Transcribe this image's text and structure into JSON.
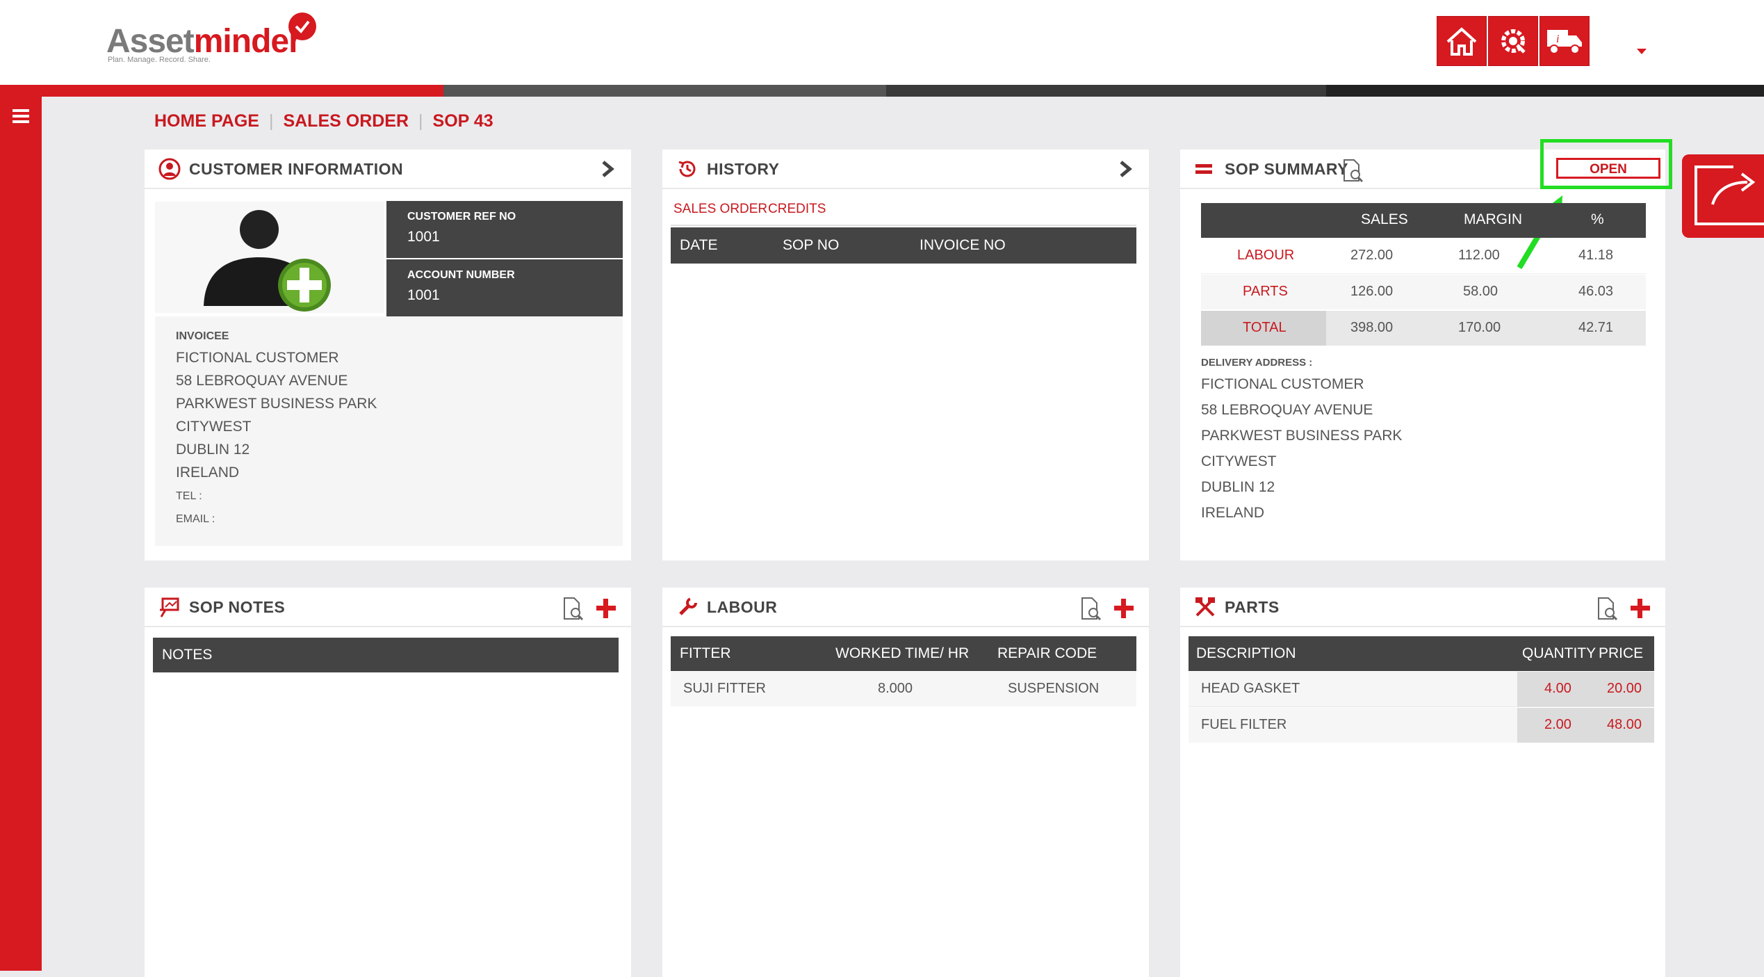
{
  "brand": {
    "name_a": "Asset",
    "name_b": "minder",
    "tagline": "Plan. Manage. Record. Share."
  },
  "topbar": {
    "home_icon": "home-icon",
    "settings_icon": "gear-wrench-icon",
    "delivery_icon": "delivery-truck-icon"
  },
  "breadcrumb": {
    "home": "HOME PAGE",
    "sales_order": "SALES ORDER",
    "current": "SOP 43"
  },
  "customer": {
    "title": "CUSTOMER INFORMATION",
    "ref_label": "CUSTOMER REF NO",
    "ref_value": "1001",
    "acct_label": "ACCOUNT NUMBER",
    "acct_value": "1001",
    "invoicee_label": "INVOICEE",
    "address": [
      "FICTIONAL CUSTOMER",
      "58 LEBROQUAY AVENUE",
      "PARKWEST BUSINESS PARK",
      "CITYWEST",
      "DUBLIN 12",
      "IRELAND"
    ],
    "tel_label": "TEL :",
    "email_label": "EMAIL :"
  },
  "history": {
    "title": "HISTORY",
    "tabs": [
      "SALES ORDER",
      "CREDITS"
    ],
    "columns": [
      "DATE",
      "SOP NO",
      "INVOICE NO"
    ]
  },
  "summary": {
    "title": "SOP SUMMARY",
    "status": "OPEN",
    "columns": [
      "SALES",
      "MARGIN",
      "%"
    ],
    "rows": [
      {
        "label": "LABOUR",
        "sales": "272.00",
        "margin": "112.00",
        "pct": "41.18"
      },
      {
        "label": "PARTS",
        "sales": "126.00",
        "margin": "58.00",
        "pct": "46.03"
      },
      {
        "label": "TOTAL",
        "sales": "398.00",
        "margin": "170.00",
        "pct": "42.71"
      }
    ],
    "delivery_label": "DELIVERY ADDRESS :",
    "delivery": [
      "FICTIONAL CUSTOMER",
      "58 LEBROQUAY AVENUE",
      "PARKWEST BUSINESS PARK",
      "CITYWEST",
      "DUBLIN 12",
      "IRELAND"
    ]
  },
  "notes": {
    "title": "SOP NOTES",
    "column": "NOTES"
  },
  "labour": {
    "title": "LABOUR",
    "columns": [
      "FITTER",
      "WORKED TIME/ HR",
      "REPAIR CODE"
    ],
    "rows": [
      {
        "fitter": "SUJI FITTER",
        "time": "8.000",
        "code": "SUSPENSION"
      }
    ]
  },
  "parts": {
    "title": "PARTS",
    "columns": [
      "DESCRIPTION",
      "QUANTITY",
      "PRICE"
    ],
    "rows": [
      {
        "desc": "HEAD GASKET",
        "qty": "4.00",
        "price": "20.00"
      },
      {
        "desc": "FUEL FILTER",
        "qty": "2.00",
        "price": "48.00"
      }
    ]
  },
  "colors": {
    "brand_red": "#d71920",
    "dark_header": "#444444",
    "highlight_green": "#22dd22"
  }
}
